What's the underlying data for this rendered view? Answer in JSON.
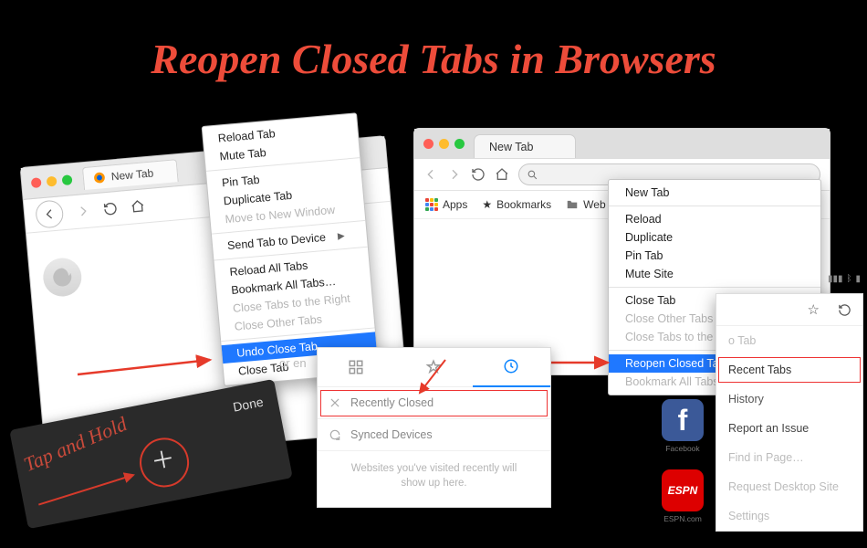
{
  "title": "Reopen Closed Tabs in Browsers",
  "firefox": {
    "tab_label": "New Tab",
    "menu": {
      "reload": "Reload Tab",
      "mute": "Mute Tab",
      "pin": "Pin Tab",
      "duplicate": "Duplicate Tab",
      "move_new_window": "Move to New Window",
      "send_to_device": "Send Tab to Device",
      "reload_all": "Reload All Tabs",
      "bookmark_all": "Bookmark All Tabs…",
      "close_right": "Close Tabs to the Right",
      "close_other": "Close Other Tabs",
      "undo_close": "Undo Close Tab",
      "close": "Close Tab"
    }
  },
  "chrome": {
    "tab_label": "New Tab",
    "url_value": "",
    "bookmarks": {
      "apps": "Apps",
      "bookmarks": "Bookmarks",
      "web": "Web"
    },
    "menu": {
      "new_tab": "New Tab",
      "reload": "Reload",
      "duplicate": "Duplicate",
      "pin": "Pin Tab",
      "mute": "Mute Site",
      "close": "Close Tab",
      "close_other": "Close Other Tabs",
      "close_right": "Close Tabs to the Right",
      "reopen": "Reopen Closed Tab",
      "bookmark_all": "Bookmark All Tabs…"
    }
  },
  "history_panel": {
    "enter_hint": "or en",
    "recently_closed": "Recently Closed",
    "synced": "Synced Devices",
    "empty": "Websites you've visited recently will show up here."
  },
  "mobile_safari": {
    "tap_hold": "Tap and Hold",
    "done": "Done"
  },
  "chrome_mobile": {
    "to_tab": "o Tab",
    "recent_tabs": "Recent Tabs",
    "history": "History",
    "report": "Report an Issue",
    "find": "Find in Page…",
    "request_desktop": "Request Desktop Site",
    "settings": "Settings",
    "apps": {
      "facebook": "Facebook",
      "espn": "ESPN.com"
    }
  }
}
